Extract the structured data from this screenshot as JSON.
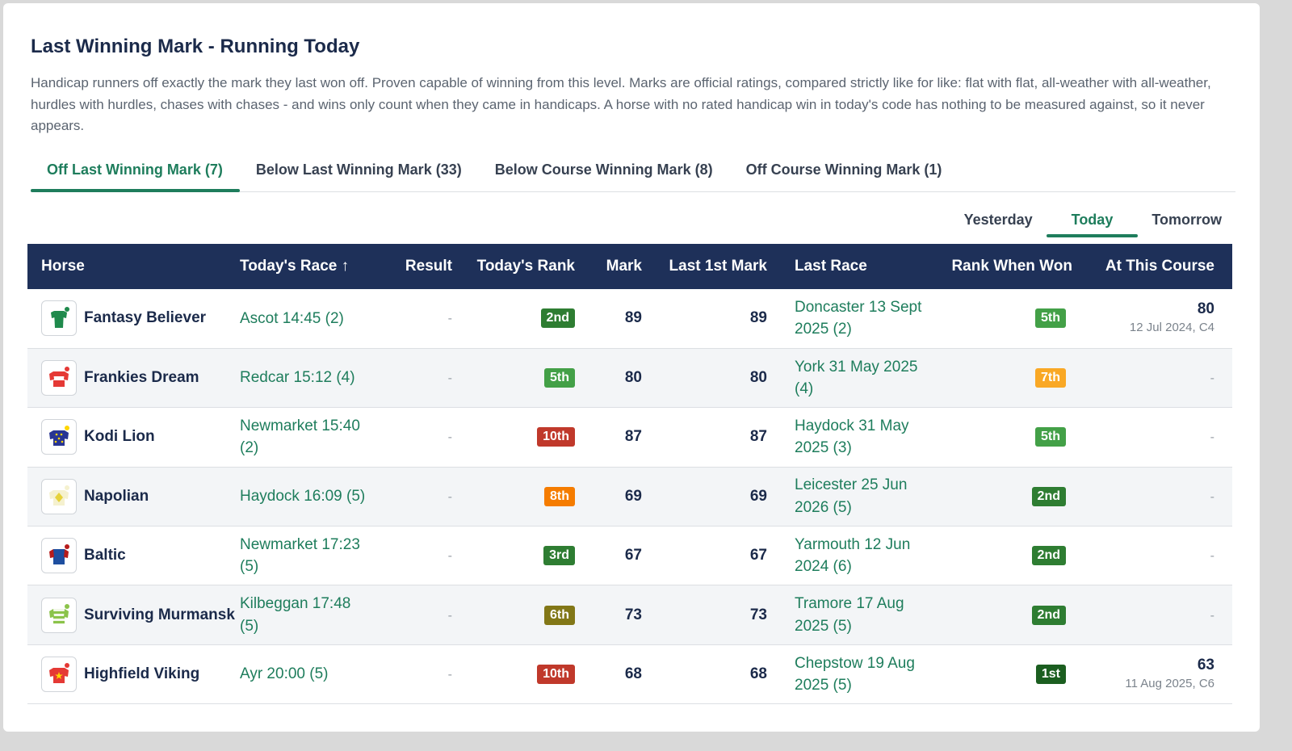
{
  "page": {
    "title": "Last Winning Mark - Running Today",
    "intro": "Handicap runners off exactly the mark they last won off. Proven capable of winning from this level. Marks are official ratings, compared strictly like for like: flat with flat, all-weather with all-weather, hurdles with hurdles, chases with chases - and wins only count when they came in handicaps. A horse with no rated handicap win in today's code has nothing to be measured against, so it never appears."
  },
  "tabs": [
    {
      "label": "Off Last Winning Mark (7)",
      "active": true
    },
    {
      "label": "Below Last Winning Mark (33)",
      "active": false
    },
    {
      "label": "Below Course Winning Mark (8)",
      "active": false
    },
    {
      "label": "Off Course Winning Mark (1)",
      "active": false
    }
  ],
  "days": [
    {
      "label": "Yesterday",
      "active": false
    },
    {
      "label": "Today",
      "active": true
    },
    {
      "label": "Tomorrow",
      "active": false
    }
  ],
  "table": {
    "headers": {
      "horse": "Horse",
      "race": "Today's Race ↑",
      "result": "Result",
      "rank": "Today's Rank",
      "mark": "Mark",
      "last_mark": "Last 1st Mark",
      "last_race": "Last Race",
      "rank_won": "Rank When Won",
      "course": "At This Course"
    },
    "colors": {
      "link": "#1e7d5c",
      "header_bg": "#1e3059"
    },
    "rows": [
      {
        "horse": "Fantasy Believer",
        "silk": "green-plain-silk-icon",
        "race": "Ascot 14:45 (2)",
        "result": "-",
        "rank": "2nd",
        "rank_color": "#2e7d32",
        "mark": "89",
        "last_mark": "89",
        "last_race": "Doncaster 13 Sept 2025 (2)",
        "rank_won": "5th",
        "rank_won_color": "#43a047",
        "course_mark": "80",
        "course_sub": "12 Jul 2024, C4"
      },
      {
        "horse": "Frankies Dream",
        "silk": "red-white-hoop-silk-icon",
        "race": "Redcar 15:12 (4)",
        "result": "-",
        "rank": "5th",
        "rank_color": "#43a047",
        "mark": "80",
        "last_mark": "80",
        "last_race": "York 31 May 2025 (4)",
        "rank_won": "7th",
        "rank_won_color": "#f9a825",
        "course_mark": "-",
        "course_sub": ""
      },
      {
        "horse": "Kodi Lion",
        "silk": "navy-yellow-stars-silk-icon",
        "race": "Newmarket 15:40 (2)",
        "result": "-",
        "rank": "10th",
        "rank_color": "#c0392b",
        "mark": "87",
        "last_mark": "87",
        "last_race": "Haydock 31 May 2025 (3)",
        "rank_won": "5th",
        "rank_won_color": "#43a047",
        "course_mark": "-",
        "course_sub": ""
      },
      {
        "horse": "Napolian",
        "silk": "cream-yellow-diamond-silk-icon",
        "race": "Haydock 16:09 (5)",
        "result": "-",
        "rank": "8th",
        "rank_color": "#f57c00",
        "mark": "69",
        "last_mark": "69",
        "last_race": "Leicester 25 Jun 2026 (5)",
        "rank_won": "2nd",
        "rank_won_color": "#2e7d32",
        "course_mark": "-",
        "course_sub": ""
      },
      {
        "horse": "Baltic",
        "silk": "blue-red-silk-icon",
        "race": "Newmarket 17:23 (5)",
        "result": "-",
        "rank": "3rd",
        "rank_color": "#2e7d32",
        "mark": "67",
        "last_mark": "67",
        "last_race": "Yarmouth 12 Jun 2024 (6)",
        "rank_won": "2nd",
        "rank_won_color": "#2e7d32",
        "course_mark": "-",
        "course_sub": ""
      },
      {
        "horse": "Surviving Murmansk",
        "silk": "green-white-hoops-silk-icon",
        "race": "Kilbeggan 17:48 (5)",
        "result": "-",
        "rank": "6th",
        "rank_color": "#827717",
        "mark": "73",
        "last_mark": "73",
        "last_race": "Tramore 17 Aug 2025 (5)",
        "rank_won": "2nd",
        "rank_won_color": "#2e7d32",
        "course_mark": "-",
        "course_sub": ""
      },
      {
        "horse": "Highfield Viking",
        "silk": "red-yellow-star-silk-icon",
        "race": "Ayr 20:00 (5)",
        "result": "-",
        "rank": "10th",
        "rank_color": "#c0392b",
        "mark": "68",
        "last_mark": "68",
        "last_race": "Chepstow 19 Aug 2025 (5)",
        "rank_won": "1st",
        "rank_won_color": "#1b5e20",
        "course_mark": "63",
        "course_sub": "11 Aug 2025, C6"
      }
    ]
  }
}
